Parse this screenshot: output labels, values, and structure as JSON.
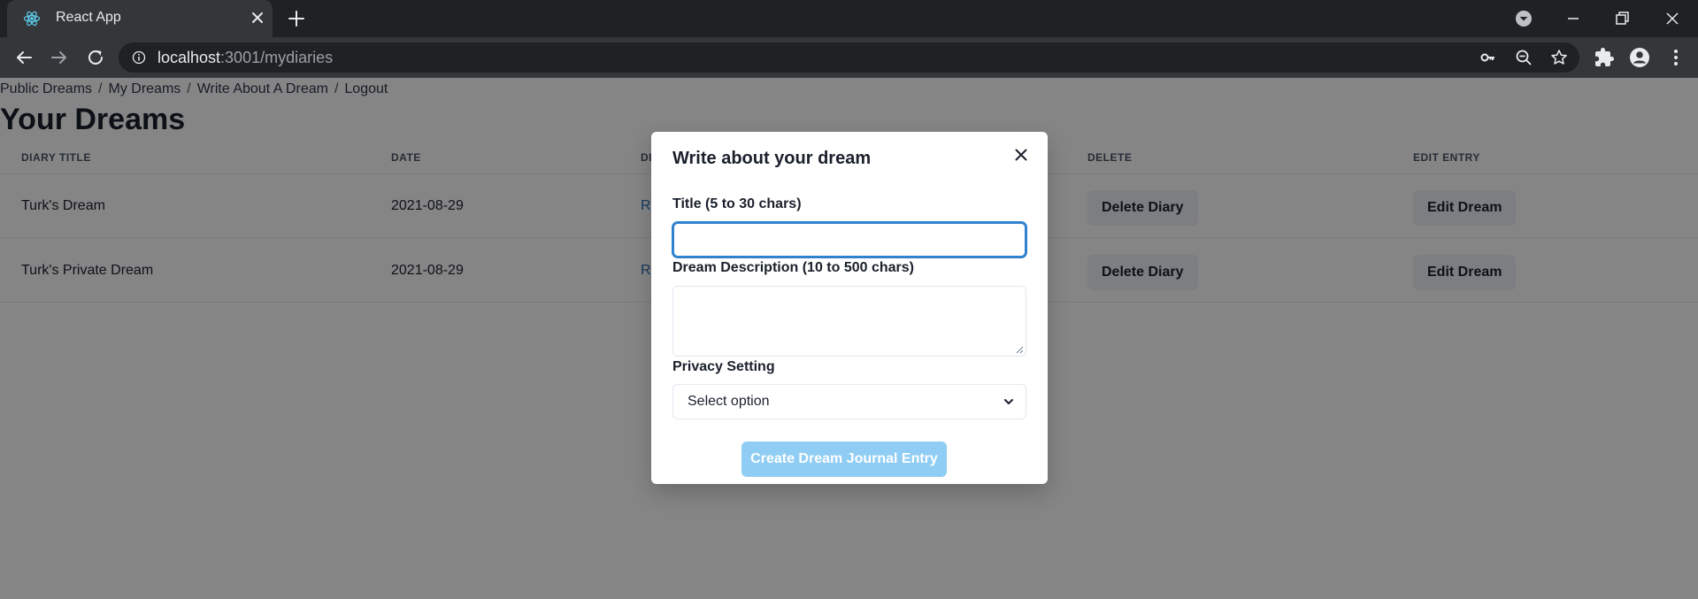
{
  "browser": {
    "tab_title": "React App",
    "url_host": "localhost",
    "url_path": ":3001/mydiaries"
  },
  "nav": {
    "items": [
      "Public Dreams",
      "My Dreams",
      "Write About A Dream",
      "Logout"
    ],
    "separator": "/"
  },
  "page": {
    "title": "Your Dreams"
  },
  "table": {
    "headers": [
      "DIARY TITLE",
      "DATE",
      "DI",
      "DELETE",
      "EDIT ENTRY"
    ],
    "rows": [
      {
        "title": "Turk's Dream",
        "date": "2021-08-29",
        "link": "Re",
        "delete": "Delete Diary",
        "edit": "Edit Dream"
      },
      {
        "title": "Turk's Private Dream",
        "date": "2021-08-29",
        "link": "Re",
        "delete": "Delete Diary",
        "edit": "Edit Dream"
      }
    ]
  },
  "modal": {
    "title": "Write about your dream",
    "title_field_label": "Title (5 to 30 chars)",
    "title_field_value": "",
    "description_label": "Dream Description (10 to 500 chars)",
    "description_value": "",
    "privacy_label": "Privacy Setting",
    "privacy_selected": "Select option",
    "submit_label": "Create Dream Journal Entry"
  },
  "colors": {
    "chrome_dark": "#202124",
    "chrome_tab": "#35363a",
    "overlay": "rgba(0,0,0,0.48)",
    "focus_border": "#3182ce",
    "submit_disabled": "#90cdf4",
    "gray_button": "#edf2f7"
  }
}
